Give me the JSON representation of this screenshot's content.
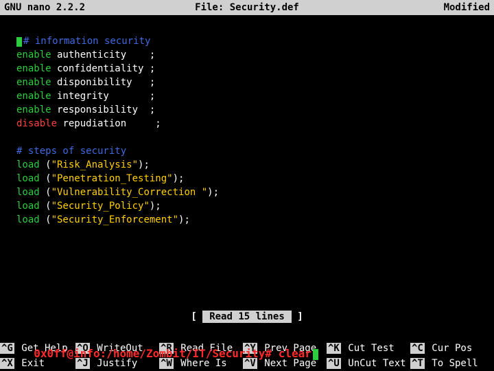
{
  "titlebar": {
    "app": "GNU nano 2.2.2",
    "file_label": "File: Security.def",
    "status": "Modified"
  },
  "editor": {
    "lines": [
      {
        "type": "comment",
        "text": "# information security"
      },
      {
        "type": "stmt",
        "kw": "enable",
        "kwClass": "kw-enable",
        "rest": " authenticity    ;"
      },
      {
        "type": "stmt",
        "kw": "enable",
        "kwClass": "kw-enable",
        "rest": " confidentiality ;"
      },
      {
        "type": "stmt",
        "kw": "enable",
        "kwClass": "kw-enable",
        "rest": " disponibility   ;"
      },
      {
        "type": "stmt",
        "kw": "enable",
        "kwClass": "kw-enable",
        "rest": " integrity       ;"
      },
      {
        "type": "stmt",
        "kw": "enable",
        "kwClass": "kw-enable",
        "rest": " responsibility  ;"
      },
      {
        "type": "stmt",
        "kw": "disable",
        "kwClass": "kw-disable",
        "rest": " repudiation     ;"
      },
      {
        "type": "blank",
        "text": ""
      },
      {
        "type": "comment",
        "text": "# steps of security"
      },
      {
        "type": "load",
        "kw": "load",
        "pre": " (",
        "str": "\"Risk_Analysis\"",
        "post": ");"
      },
      {
        "type": "load",
        "kw": "load",
        "pre": " (",
        "str": "\"Penetration_Testing\"",
        "post": ");"
      },
      {
        "type": "load",
        "kw": "load",
        "pre": " (",
        "str": "\"Vulnerability_Correction \"",
        "post": ");"
      },
      {
        "type": "load",
        "kw": "load",
        "pre": " (",
        "str": "\"Security_Policy\"",
        "post": ");"
      },
      {
        "type": "load",
        "kw": "load",
        "pre": " (",
        "str": "\"Security_Enforcement\"",
        "post": ");"
      }
    ]
  },
  "status_msg": "Read 15 lines",
  "shortcuts": {
    "row1": [
      {
        "key": "^G",
        "label": "Get Help"
      },
      {
        "key": "^O",
        "label": "WriteOut"
      },
      {
        "key": "^R",
        "label": "Read File"
      },
      {
        "key": "^Y",
        "label": "Prev Page"
      },
      {
        "key": "^K",
        "label": "Cut Test"
      },
      {
        "key": "^C",
        "label": "Cur Pos"
      }
    ],
    "row2": [
      {
        "key": "^X",
        "label": "Exit"
      },
      {
        "key": "^J",
        "label": "Justify"
      },
      {
        "key": "^W",
        "label": "Where Is"
      },
      {
        "key": "^V",
        "label": "Next Page"
      },
      {
        "key": "^U",
        "label": "UnCut Text"
      },
      {
        "key": "^T",
        "label": "To Spell"
      }
    ]
  },
  "overlay": {
    "prompt": "0x0ff@info:/home/Zombit/IT/Security# ",
    "command": "clear"
  }
}
